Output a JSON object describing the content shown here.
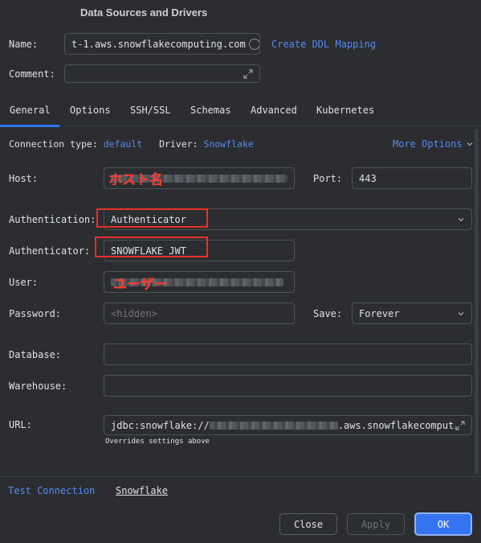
{
  "dialog": {
    "title": "Data Sources and Drivers"
  },
  "name_row": {
    "label": "Name:",
    "value": "t-1.aws.snowflakecomputing.com",
    "ddl_link": "Create DDL Mapping"
  },
  "comment_row": {
    "label": "Comment:",
    "value": ""
  },
  "tabs": [
    {
      "label": "General"
    },
    {
      "label": "Options"
    },
    {
      "label": "SSH/SSL"
    },
    {
      "label": "Schemas"
    },
    {
      "label": "Advanced"
    },
    {
      "label": "Kubernetes"
    }
  ],
  "connection": {
    "type_label": "Connection type:",
    "type_value": "default",
    "driver_label": "Driver:",
    "driver_value": "Snowflake",
    "more_options": "More Options"
  },
  "host": {
    "label": "Host:",
    "annotation": "ホスト名"
  },
  "port": {
    "label": "Port:",
    "value": "443"
  },
  "authentication": {
    "label": "Authentication:",
    "value": "Authenticator"
  },
  "authenticator": {
    "label": "Authenticator:",
    "value": "SNOWFLAKE_JWT"
  },
  "user": {
    "label": "User:",
    "annotation": "ユーザー"
  },
  "password": {
    "label": "Password:",
    "placeholder": "<hidden>"
  },
  "save": {
    "label": "Save:",
    "value": "Forever"
  },
  "database": {
    "label": "Database:",
    "value": ""
  },
  "warehouse": {
    "label": "Warehouse:",
    "value": ""
  },
  "url": {
    "label": "URL:",
    "prefix": "jdbc:snowflake://",
    "suffix": ".aws.snowflakecomputi",
    "hint": "Overrides settings above"
  },
  "footer": {
    "test_connection": "Test Connection",
    "driver_link": "Snowflake"
  },
  "buttons": {
    "close": "Close",
    "apply": "Apply",
    "ok": "OK"
  },
  "colors": {
    "accent": "#3574f0",
    "link": "#548af7",
    "annotation": "#e8312a",
    "background": "#2b2d30"
  }
}
